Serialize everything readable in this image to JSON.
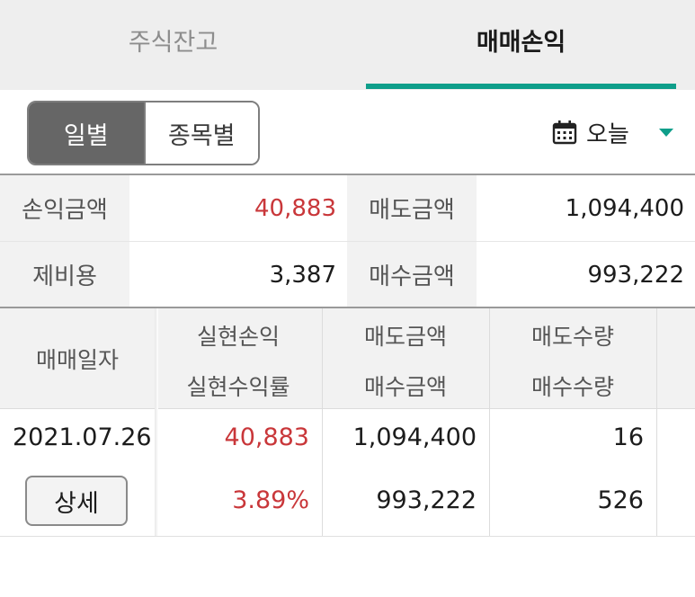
{
  "tabs": [
    {
      "label": "주식잔고",
      "active": false
    },
    {
      "label": "매매손익",
      "active": true
    }
  ],
  "segment": {
    "daily": "일별",
    "by_stock": "종목별"
  },
  "date_selector": {
    "label": "오늘",
    "icon": "calendar-icon"
  },
  "summary": {
    "profit_label": "손익금액",
    "profit_value": "40,883",
    "sell_amount_label": "매도금액",
    "sell_amount_value": "1,094,400",
    "fee_label": "제비용",
    "fee_value": "3,387",
    "buy_amount_label": "매수금액",
    "buy_amount_value": "993,222"
  },
  "detail_table": {
    "headers": {
      "date": "매매일자",
      "realized_profit": "실현손익",
      "realized_rate": "실현수익률",
      "sell_amount": "매도금액",
      "buy_amount": "매수금액",
      "sell_qty": "매도수량",
      "buy_qty": "매수수량"
    },
    "rows": [
      {
        "date": "2021.07.26",
        "detail_button": "상세",
        "realized_profit": "40,883",
        "realized_rate": "3.89%",
        "sell_amount": "1,094,400",
        "buy_amount": "993,222",
        "sell_qty": "16",
        "buy_qty": "526"
      }
    ]
  },
  "colors": {
    "accent": "#0e9e8a",
    "profit": "#c9373a",
    "segment_active": "#666666"
  }
}
